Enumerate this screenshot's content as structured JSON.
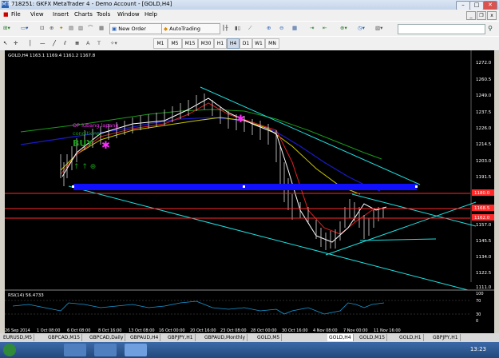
{
  "window": {
    "title": "718251: GKFX MetaTrader 4 - Demo Account - [GOLD,H4]",
    "app_icon": "MT4",
    "minimize": "–",
    "maximize": "□",
    "close": "✕",
    "inner_minimize": "_",
    "inner_restore": "❐",
    "inner_close": "x"
  },
  "menu": [
    "File",
    "View",
    "Insert",
    "Charts",
    "Tools",
    "Window",
    "Help"
  ],
  "toolbar": {
    "new_order": "New Order",
    "autotrading": "AutoTrading"
  },
  "timeframes": [
    "M1",
    "M5",
    "M15",
    "M30",
    "H1",
    "H4",
    "D1",
    "W1",
    "MN"
  ],
  "active_timeframe": "H4",
  "chart": {
    "symbol_info": "GOLD,H4  1163.1 1169.4 1161.2 1167.8",
    "annotation_line1": "OP lubang lapang",
    "annotation_line2": "conditions:",
    "annotation_line3": "BUY",
    "price_ticks": [
      "1272.0",
      "1260.5",
      "1249.0",
      "1237.5",
      "1226.0",
      "1214.5",
      "1203.0",
      "1191.5",
      "1180.0",
      "1168.5",
      "1157.0",
      "1145.5",
      "1134.0",
      "1122.5",
      "1111.0"
    ],
    "price_labels": [
      "1180.0",
      "1168.5",
      "1162.0"
    ],
    "rsi_label": "RSI(14) 56.4733",
    "rsi_ticks": [
      "70",
      "30",
      "0"
    ],
    "rsi_top": "100",
    "time_ticks": [
      "26 Sep 2014",
      "1 Oct 08:00",
      "6 Oct 08:00",
      "8 Oct 16:00",
      "13 Oct 08:00",
      "16 Oct 00:00",
      "20 Oct 16:00",
      "23 Oct 08:00",
      "28 Oct 00:00",
      "30 Oct 16:00",
      "4 Nov 08:00",
      "7 Nov 00:00",
      "11 Nov 16:00"
    ],
    "colors": {
      "background": "#000000",
      "channel": "#1ee0e0",
      "red_line": "#ff2a2a",
      "blue_bar": "#1010ff",
      "ma_green": "#1a9a1a",
      "ma_blue": "#1a1acc",
      "ma_yellow": "#c8c800",
      "ma_red": "#e02020",
      "ma_white": "#ffffff",
      "annotation": "#ff2aff"
    }
  },
  "tabs": [
    "EURUSD,M5",
    "GBPCAD,M15",
    "GBPCAD,Daily",
    "GBPAUD,H4",
    "GBPJPY,H1",
    "GBPAUD,Monthly",
    "GOLD,M5",
    "GOLD,H4",
    "GOLD,M15",
    "GOLD,H1",
    "GBPJPY,H1"
  ],
  "active_tab": "GOLD,H4",
  "taskbar": {
    "clock": "13:23"
  }
}
